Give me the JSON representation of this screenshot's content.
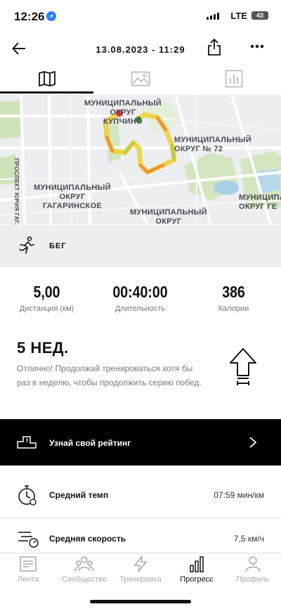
{
  "status": {
    "time": "12:26",
    "network": "LTE",
    "battery": "43"
  },
  "header": {
    "title": "13.08.2023 - 11:29"
  },
  "tabs": [
    {
      "name": "map",
      "active": true
    },
    {
      "name": "photo",
      "active": false
    },
    {
      "name": "stats",
      "active": false
    }
  ],
  "map": {
    "labels": {
      "kupchino": "МУНИЦИПАЛЬНЫЙ\nОКРУГ\nКУПЧИНО",
      "okrug72": "МУНИЦИПАЛЬНЫЙ\nОКРУГ № 72",
      "gagarinskoe": "МУНИЦИПАЛЬНЫЙ\nОКРУГ\nГАГАРИНСКОЕ",
      "okrug_bottom": "МУНИЦИПАЛЬНЫЙ\nОКРУГ",
      "right_edge": "МУНИЦИПАЛЬНЫЙ\nОКРУГ ГЕ",
      "prospect": "ПРОСПЕКТ ЮРИЯ ГАГАРИНА"
    }
  },
  "activity": {
    "icon": "running-person-icon",
    "label": "БЕГ"
  },
  "stats": [
    {
      "value": "5,00",
      "label": "Дистанция (км)"
    },
    {
      "value": "00:40:00",
      "label": "Длительность"
    },
    {
      "value": "386",
      "label": "Калории"
    }
  ],
  "streak": {
    "title": "5 НЕД.",
    "text": "Отлично! Продолжай тренироваться хотя бы раз в неделю, чтобы продолжить серию побед."
  },
  "ranking": {
    "label": "Узнай свой рейтинг"
  },
  "metrics": [
    {
      "label": "Средний темп",
      "value": "07:59 мин/км"
    },
    {
      "label": "Средняя скорость",
      "value": "7,5 км/ч"
    }
  ],
  "nav": [
    {
      "label": "Лента",
      "active": false
    },
    {
      "label": "Сообщество",
      "active": false
    },
    {
      "label": "Тренировка",
      "active": false
    },
    {
      "label": "Прогресс",
      "active": true
    },
    {
      "label": "Профиль",
      "active": false
    }
  ]
}
